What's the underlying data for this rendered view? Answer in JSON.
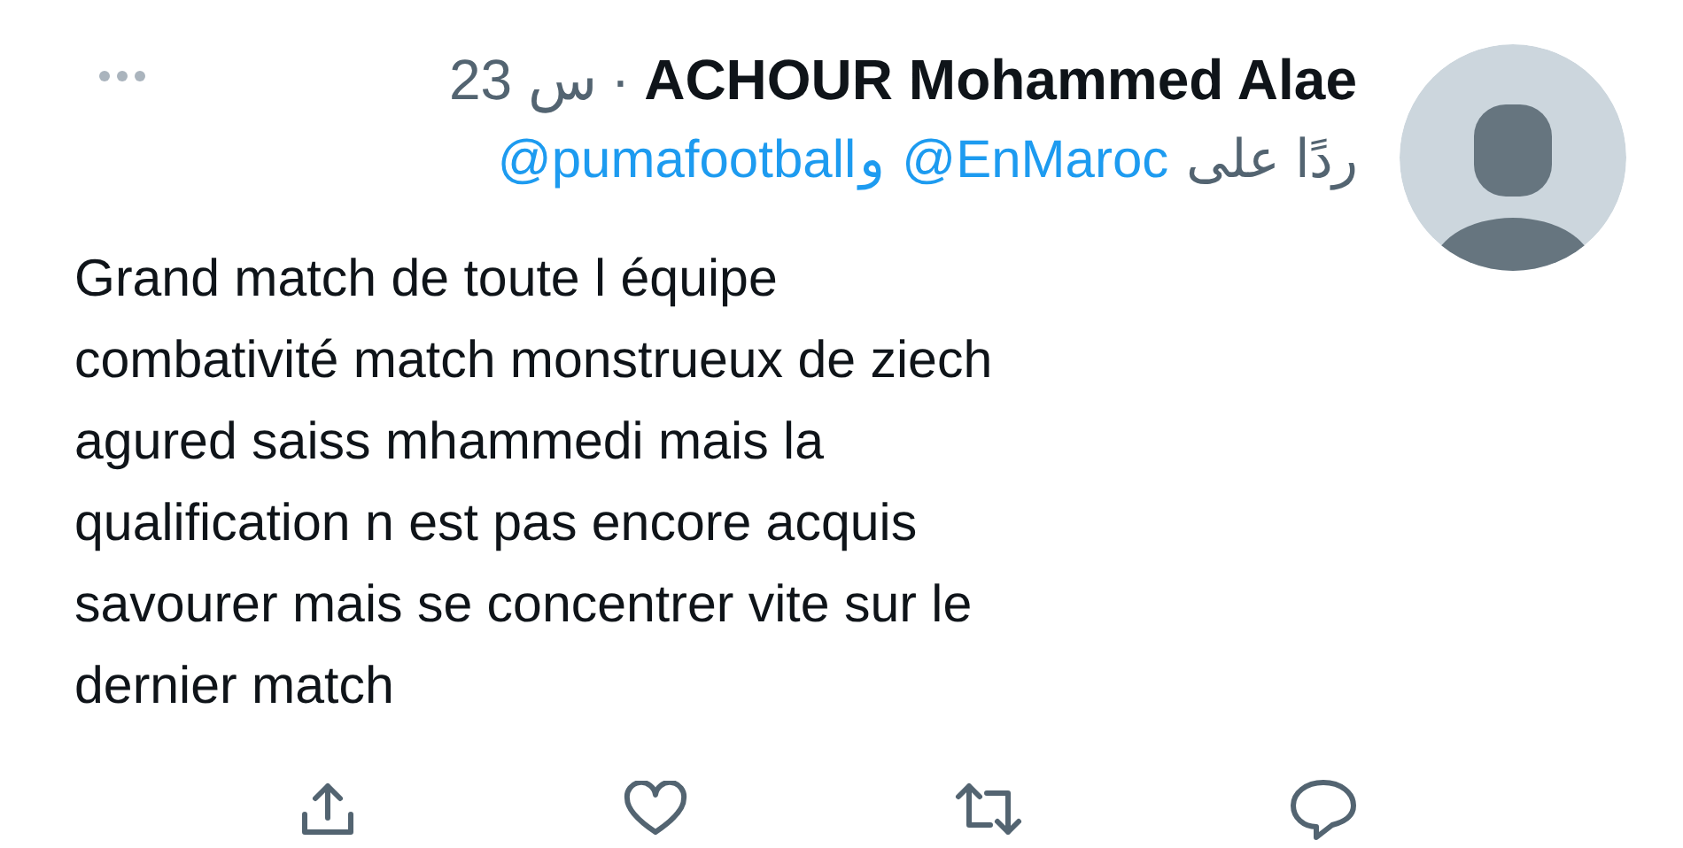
{
  "tweet": {
    "author": "ACHOUR Mohammed Alae",
    "separator": "·",
    "time": "23 س",
    "mentions": [
      "@pumafootball",
      "@EnMaroc"
    ],
    "conjunction": "و",
    "reply_prefix": "ردًا على",
    "text": "Grand match de toute l équipe\ncombativité match monstrueux de ziech\nagured saiss mhammedi mais la\nqualification n est pas encore acquis\nsavourer mais se concentrer vite sur le\ndernier match"
  },
  "actions": [
    {
      "kind": "share"
    },
    {
      "kind": "like"
    },
    {
      "kind": "retweet"
    },
    {
      "kind": "reply"
    }
  ]
}
